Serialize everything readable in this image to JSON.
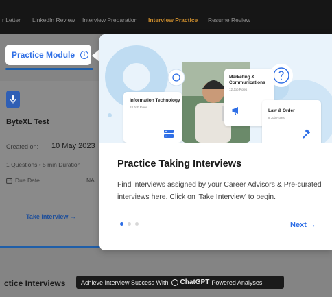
{
  "nav": {
    "items": [
      {
        "label": "r Letter",
        "active": false
      },
      {
        "label": "LinkedIn Review",
        "active": false
      },
      {
        "label": "Interview Preparation",
        "active": false
      },
      {
        "label": "Interview Practice",
        "active": true
      },
      {
        "label": "Resume Review",
        "active": false
      }
    ]
  },
  "practice_module": {
    "label": "Practice Module",
    "icon": "info-icon"
  },
  "test_card": {
    "icon": "microphone-icon",
    "title": "ByteXL Test",
    "created_label": "Created on:",
    "created_date": "10 May 2023",
    "meta": "1 Questions • 5 min Duration",
    "due_label": "Due Date",
    "due_value": "NA",
    "take_label": "Take Interview →"
  },
  "bottom": {
    "title": "ctice Interviews",
    "pill_before": "Achieve Interview Success With",
    "pill_brand": "ChatGPT",
    "pill_after": "Powered Analyses"
  },
  "popover": {
    "cards": {
      "info_tech": {
        "title": "Information Technology",
        "sub": "18 Job Roles"
      },
      "marketing": {
        "title": "Marketing & Communications",
        "sub": "12 Job Roles"
      },
      "law": {
        "title": "Law & Order",
        "sub": "8 Job Roles"
      }
    },
    "title": "Practice Taking Interviews",
    "description": "Find interviews assigned by your Career Advisors & Pre-curated interviews here. Click on 'Take Interview' to begin.",
    "pagination": {
      "current": 1,
      "total": 3
    },
    "next_label": "Next →",
    "colors": {
      "accent": "#2f6fe6",
      "circle": "#bfdcf2"
    }
  }
}
